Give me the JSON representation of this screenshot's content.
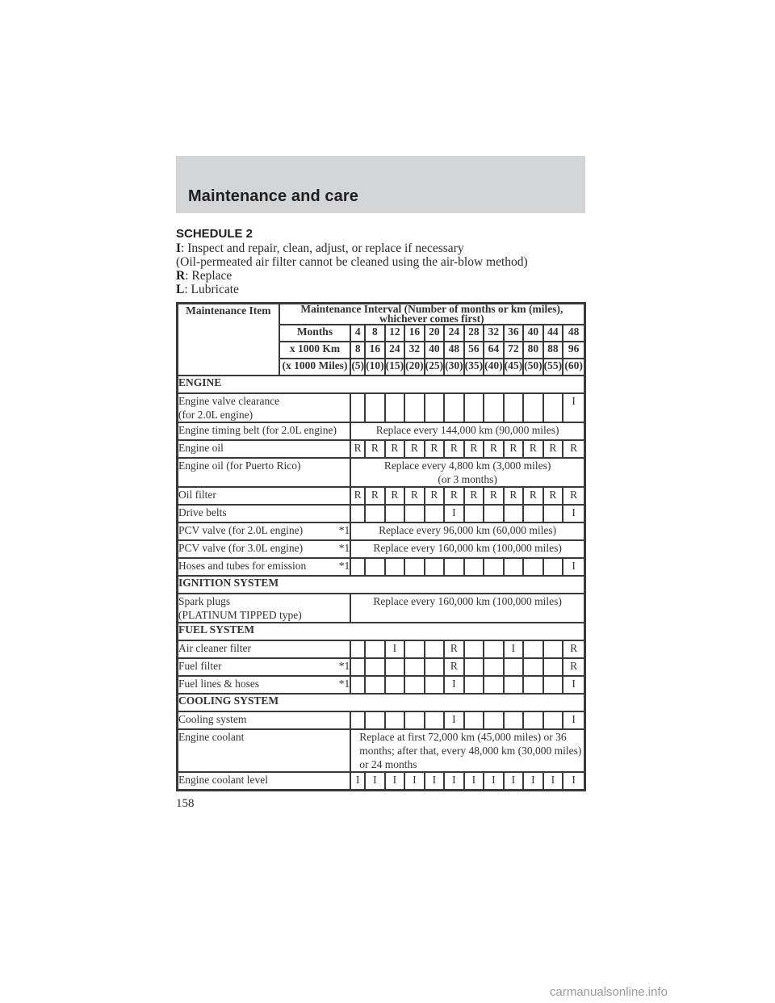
{
  "section_header": "Maintenance and care",
  "schedule_title": "SCHEDULE 2",
  "legend": [
    {
      "key": "I",
      "text": ": Inspect and repair, clean, adjust, or replace if necessary"
    },
    {
      "key": "",
      "text": "(Oil-permeated air filter cannot be cleaned using the air-blow method)"
    },
    {
      "key": "R",
      "text": ": Replace"
    },
    {
      "key": "L",
      "text": ": Lubricate"
    }
  ],
  "table": {
    "item_header": "Maintenance Item",
    "interval_header_line1": "Maintenance Interval (Number of months or km (miles),",
    "interval_header_line2": "whichever comes first)",
    "months_label": "Months",
    "km_label": "x 1000 Km",
    "miles_label": "(x 1000 Miles)",
    "months": [
      "4",
      "8",
      "12",
      "16",
      "20",
      "24",
      "28",
      "32",
      "36",
      "40",
      "44",
      "48"
    ],
    "km": [
      "8",
      "16",
      "24",
      "32",
      "40",
      "48",
      "56",
      "64",
      "72",
      "80",
      "88",
      "96"
    ],
    "miles": [
      "(5)",
      "(10)",
      "(15)",
      "(20)",
      "(25)",
      "(30)",
      "(35)",
      "(40)",
      "(45)",
      "(50)",
      "(55)",
      "(60)"
    ],
    "groups": [
      {
        "name": "ENGINE",
        "rows": [
          {
            "item": "Engine valve clearance",
            "item2": "(for 2.0L engine)",
            "note": "",
            "marks": [
              "",
              "",
              "",
              "",
              "",
              "",
              "",
              "",
              "",
              "",
              "",
              "I"
            ]
          },
          {
            "item": "Engine timing belt (for 2.0L engine)",
            "note": "",
            "span": "Replace every 144,000 km (90,000 miles)"
          },
          {
            "item": "Engine oil",
            "note": "",
            "marks": [
              "R",
              "R",
              "R",
              "R",
              "R",
              "R",
              "R",
              "R",
              "R",
              "R",
              "R",
              "R"
            ]
          },
          {
            "item": "Engine oil (for Puerto Rico)",
            "note": "",
            "span": "Replace every 4,800 km (3,000 miles)",
            "span2": "(or 3 months)"
          },
          {
            "item": "Oil filter",
            "note": "",
            "marks": [
              "R",
              "R",
              "R",
              "R",
              "R",
              "R",
              "R",
              "R",
              "R",
              "R",
              "R",
              "R"
            ]
          },
          {
            "item": "Drive belts",
            "note": "",
            "marks": [
              "",
              "",
              "",
              "",
              "",
              "I",
              "",
              "",
              "",
              "",
              "",
              "I"
            ]
          },
          {
            "item": "PCV valve (for 2.0L engine)",
            "note": "*1",
            "span": "Replace every 96,000 km (60,000 miles)"
          },
          {
            "item": "PCV valve (for 3.0L engine)",
            "note": "*1",
            "span": "Replace every 160,000 km (100,000 miles)"
          },
          {
            "item": "Hoses and tubes for emission",
            "note": "*1",
            "marks": [
              "",
              "",
              "",
              "",
              "",
              "",
              "",
              "",
              "",
              "",
              "",
              "I"
            ]
          }
        ]
      },
      {
        "name": "IGNITION SYSTEM",
        "rows": [
          {
            "item": "Spark plugs",
            "item2": "(PLATINUM TIPPED type)",
            "note": "",
            "span": "Replace every 160,000 km (100,000 miles)"
          }
        ]
      },
      {
        "name": "FUEL SYSTEM",
        "rows": [
          {
            "item": "Air cleaner filter",
            "note": "",
            "marks": [
              "",
              "",
              "I",
              "",
              "",
              "R",
              "",
              "",
              "I",
              "",
              "",
              "R"
            ]
          },
          {
            "item": "Fuel filter",
            "note": "*1",
            "marks": [
              "",
              "",
              "",
              "",
              "",
              "R",
              "",
              "",
              "",
              "",
              "",
              "R"
            ]
          },
          {
            "item": "Fuel lines & hoses",
            "note": "*1",
            "marks": [
              "",
              "",
              "",
              "",
              "",
              "I",
              "",
              "",
              "",
              "",
              "",
              "I"
            ]
          }
        ]
      },
      {
        "name": "COOLING SYSTEM",
        "rows": [
          {
            "item": "Cooling system",
            "note": "",
            "marks": [
              "",
              "",
              "",
              "",
              "",
              "I",
              "",
              "",
              "",
              "",
              "",
              "I"
            ]
          },
          {
            "item": "Engine coolant",
            "note": "",
            "span": "Replace at first 72,000 km (45,000 miles) or 36 months; after that, every 48,000 km (30,000 miles) or 24 months",
            "span_align": "left"
          },
          {
            "item": "Engine coolant level",
            "note": "",
            "marks": [
              "I",
              "I",
              "I",
              "I",
              "I",
              "I",
              "I",
              "I",
              "I",
              "I",
              "I",
              "I"
            ]
          }
        ]
      }
    ]
  },
  "page_number": "158",
  "watermark": "carmanualsonline.info"
}
